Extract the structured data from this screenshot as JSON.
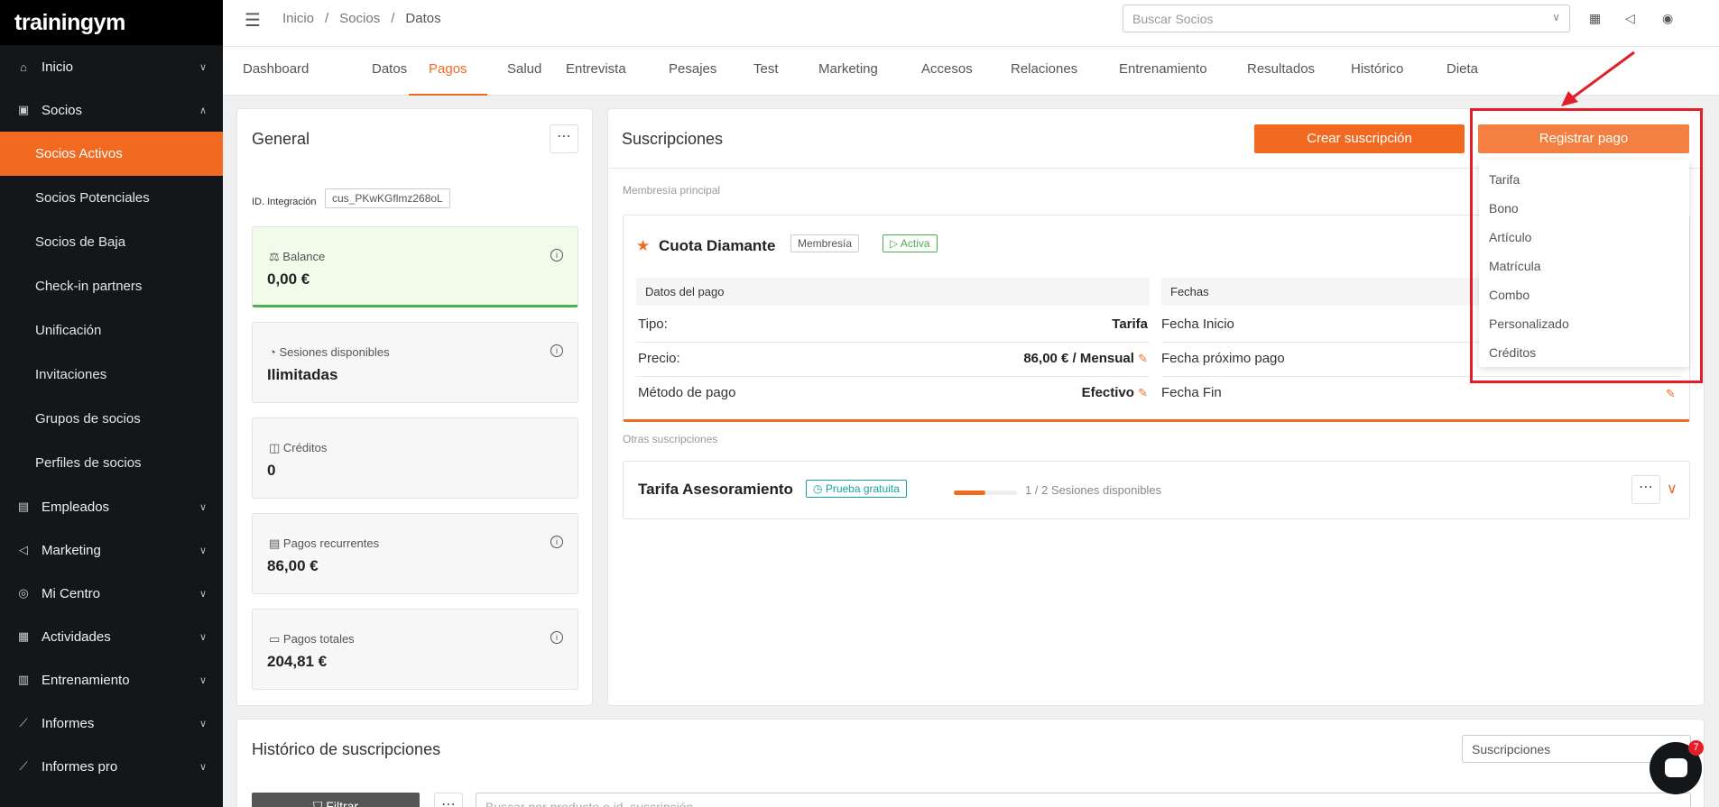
{
  "app": {
    "logo": "trainingym"
  },
  "sidebar": {
    "items": [
      {
        "label": "Inicio",
        "icon": "home-icon"
      },
      {
        "label": "Socios",
        "icon": "members-icon",
        "expanded": true
      },
      {
        "label": "Empleados",
        "icon": "employee-icon"
      },
      {
        "label": "Marketing",
        "icon": "megaphone-icon"
      },
      {
        "label": "Mi Centro",
        "icon": "location-icon"
      },
      {
        "label": "Actividades",
        "icon": "calendar-icon"
      },
      {
        "label": "Entrenamiento",
        "icon": "training-icon"
      },
      {
        "label": "Informes",
        "icon": "chart-icon"
      },
      {
        "label": "Informes pro",
        "icon": "chart-icon"
      }
    ],
    "socios_sub": [
      "Socios Activos",
      "Socios Potenciales",
      "Socios de Baja",
      "Check-in partners",
      "Unificación",
      "Invitaciones",
      "Grupos de socios",
      "Perfiles de socios"
    ]
  },
  "topbar": {
    "breadcrumb": [
      "Inicio",
      "Socios",
      "Datos"
    ],
    "search_placeholder": "Buscar Socios"
  },
  "tabs": [
    "Dashboard",
    "Datos",
    "Pagos",
    "Salud",
    "Entrevista",
    "Pesajes",
    "Test",
    "Marketing",
    "Accesos",
    "Relaciones",
    "Entrenamiento",
    "Resultados",
    "Histórico",
    "Dieta"
  ],
  "general": {
    "title": "General",
    "integration_label": "ID. Integración",
    "integration_value": "cus_PKwKGflmz268oL",
    "stats": [
      {
        "label": "Balance",
        "value": "0,00 €"
      },
      {
        "label": "Sesiones disponibles",
        "value": "Ilimitadas"
      },
      {
        "label": "Créditos",
        "value": "0"
      },
      {
        "label": "Pagos recurrentes",
        "value": "86,00 €"
      },
      {
        "label": "Pagos totales",
        "value": "204,81 €"
      }
    ]
  },
  "subs": {
    "title": "Suscripciones",
    "create_btn": "Crear suscripción",
    "register_btn": "Registrar pago",
    "main_label": "Membresía principal",
    "membership": {
      "name": "Cuota Diamante",
      "type_tag": "Membresía",
      "status_tag": "Activa",
      "pay_head": "Datos del pago",
      "dates_head": "Fechas",
      "tipo_label": "Tipo:",
      "tipo_value": "Tarifa",
      "precio_label": "Precio:",
      "precio_value": "86,00 € / Mensual",
      "metodo_label": "Método de pago",
      "metodo_value": "Efectivo",
      "fecha_inicio": "Fecha Inicio",
      "fecha_proximo": "Fecha próximo pago",
      "fecha_fin": "Fecha Fin"
    },
    "other_label": "Otras suscripciones",
    "other": {
      "name": "Tarifa Asesoramiento",
      "tag": "Prueba gratuita",
      "sessions": "1 / 2 Sesiones disponibles",
      "progress": 0.5
    }
  },
  "dropdown": [
    "Tarifa",
    "Bono",
    "Artículo",
    "Matrícula",
    "Combo",
    "Personalizado",
    "Créditos"
  ],
  "historico": {
    "title": "Histórico de suscripciones",
    "select_value": "Suscripciones",
    "filter_btn": "Filtrar",
    "search_placeholder": "Buscar por producto o id. suscripción"
  },
  "chat": {
    "badge": "7"
  }
}
